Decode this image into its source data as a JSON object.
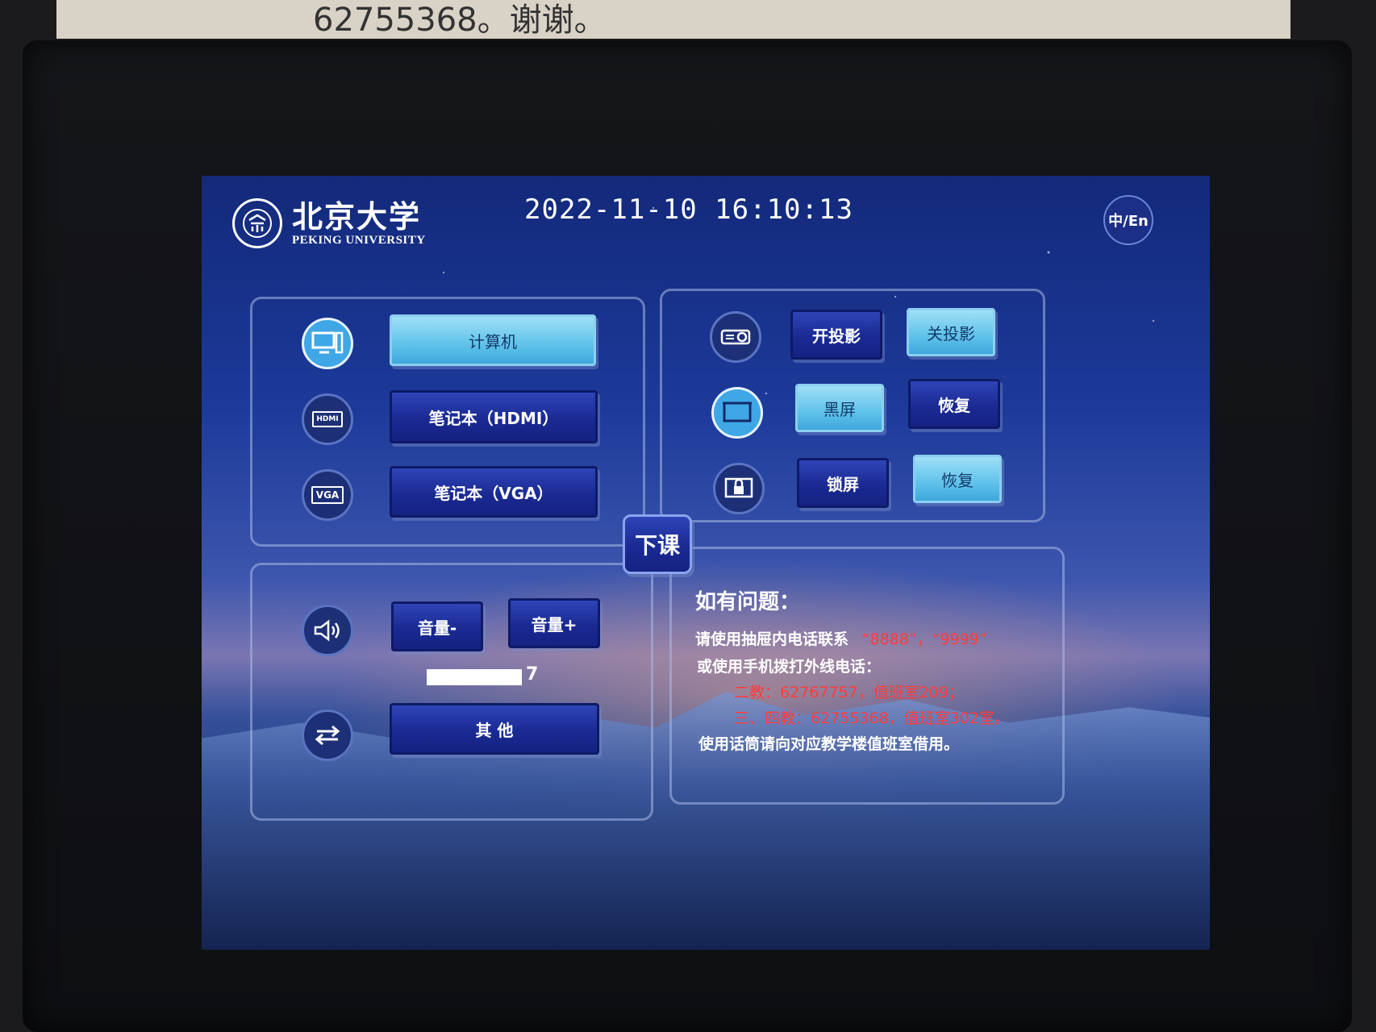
{
  "paper_note": "62755368。谢谢。",
  "header": {
    "logo_cn": "北京大学",
    "logo_en": "PEKING UNIVERSITY",
    "datetime": "2022-11-10 16:10:13",
    "lang_toggle": "中/En"
  },
  "sources": {
    "computer": "计算机",
    "hdmi": "笔记本（HDMI）",
    "hdmi_icon_text": "HDMI",
    "vga": "笔记本（VGA）",
    "vga_icon_text": "VGA"
  },
  "projector": {
    "on": "开投影",
    "off": "关投影",
    "black": "黑屏",
    "restore1": "恢复",
    "lock": "锁屏",
    "restore2": "恢复"
  },
  "class_end": "下课",
  "audio": {
    "vol_down": "音量-",
    "vol_up": "音量+",
    "level": "7",
    "other": "其 他"
  },
  "help": {
    "title": "如有问题：",
    "line1_a": "请使用抽屉内电话联系",
    "line1_b": "“8888”，“9999”",
    "line2": "或使用手机拨打外线电话：",
    "line3": "二教：62767757，值班室209；",
    "line4": "三、四教：62755368，值班室302室。",
    "line5": "使用话筒请向对应教学楼值班室借用。"
  },
  "colors": {
    "accent_light": "#5fc2ea",
    "button_dark": "#1a2a93",
    "warning_red": "#ff3b3b"
  }
}
